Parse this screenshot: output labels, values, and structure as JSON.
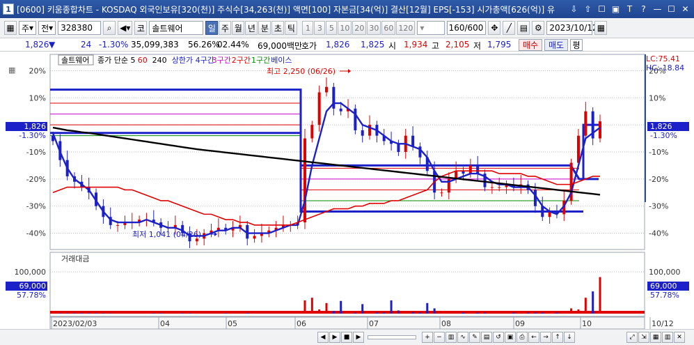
{
  "window": {
    "number": "1",
    "title": "[0600] 키움종합차트 - KOSDAQ 외국인보유[320(천)] 주식수[34,263(천)] 액면[100] 자본금[34(억)] 결산[12월] EPS[-153] 시가총액[626(억)] 유",
    "buttons": [
      "⇩",
      "⇧",
      "☐",
      "▣",
      "T",
      "?",
      "—",
      "☐",
      "✕"
    ]
  },
  "toolbar": {
    "market": "주",
    "scope": "전",
    "code": "328380",
    "name_prefix": "코",
    "name": "솔트웨어",
    "periods": [
      "일",
      "주",
      "월",
      "년",
      "분",
      "초",
      "틱"
    ],
    "active_period": "일",
    "ticks": [
      "1",
      "3",
      "5",
      "10",
      "20",
      "30",
      "60",
      "120"
    ],
    "count": "160",
    "count_total": "/600",
    "date": "2023/10/12"
  },
  "quote": {
    "price": "1,826",
    "change_arrow": "▼",
    "change": "24",
    "change_pct": "-1.30%",
    "volume": "35,099,383",
    "turnover": "56.26%",
    "ratio": "02.44%",
    "amount": "69,000백만",
    "ask_label": "호가",
    "ask": "1,826",
    "bid": "1,825",
    "open_label": "시",
    "open": "1,934",
    "high_label": "고",
    "high": "2,105",
    "low_label": "저",
    "low": "1,795",
    "buy": "매수",
    "sell": "매도",
    "eval": "평"
  },
  "legend": {
    "stock": "솔트웨어",
    "items": [
      {
        "text": "종가 단순 5",
        "color": "#000"
      },
      {
        "text": "60",
        "color": "#e00000"
      },
      {
        "text": "240",
        "color": "#000"
      },
      {
        "text": "상한가 4구간",
        "color": "#1c20c8"
      },
      {
        "text": "3구간",
        "color": "#cc00cc"
      },
      {
        "text": "2구간",
        "color": "#e00000"
      },
      {
        "text": "1구간",
        "color": "#008800"
      },
      {
        "text": "베이스",
        "color": "#1c20c8"
      }
    ]
  },
  "annotations": {
    "high": "최고 2,250 (06/26)",
    "low": "최저 1,041 (04/26)"
  },
  "right_labels": {
    "lc": "LC:75.41",
    "hc": "HC:-18.84"
  },
  "price_box": {
    "price": "1,826",
    "pct": "-1.30%"
  },
  "volume_panel": {
    "title": "거래대금",
    "axis_label": "100,000",
    "value": "69,000",
    "pct": "57.78%"
  },
  "x_axis": {
    "labels": [
      "2023/02/03",
      "04",
      "05",
      "06",
      "07",
      "08",
      "09",
      "10",
      "10/12"
    ]
  },
  "colors": {
    "up": "#e00000",
    "down": "#1c20c8",
    "ma5": "#1c20c8",
    "ma60": "#e00000",
    "ma240": "#000000"
  },
  "chart_data": [
    {
      "type": "line",
      "title": "솔트웨어",
      "y_axis": {
        "labels": [
          "20%",
          "10%",
          "0%",
          "-10%",
          "-20%",
          "-30%",
          "-40%"
        ],
        "range": [
          -45,
          25
        ]
      },
      "series": [
        {
          "name": "종가",
          "values": [
            -6,
            -13,
            -19,
            -21,
            -23,
            -25,
            -30,
            -34,
            -37,
            -37,
            -36,
            -36,
            -35,
            -35,
            -36,
            -38,
            -38,
            -37,
            -40,
            -43,
            -42,
            -40,
            -39,
            -38,
            -39,
            -38,
            -37,
            -42,
            -41,
            -40,
            -39,
            -38,
            -37,
            -37,
            -36,
            -5,
            0,
            12,
            14,
            6,
            5,
            6,
            -2,
            -4,
            0,
            -4,
            -6,
            -7,
            -10,
            -4,
            -8,
            -12,
            -17,
            -25,
            -25,
            -20,
            -17,
            -18,
            -15,
            -18,
            -23,
            -23,
            -23,
            -22,
            -23,
            -22,
            -24,
            -30,
            -34,
            -32,
            -33,
            -28,
            -14,
            -4,
            5,
            -5,
            1.3
          ]
        },
        {
          "name": "5",
          "values": [
            -3,
            -10,
            -16,
            -20,
            -22,
            -24,
            -28,
            -32,
            -35,
            -36,
            -36,
            -36,
            -36,
            -35,
            -36,
            -37,
            -38,
            -38,
            -39,
            -41,
            -41,
            -41,
            -40,
            -39,
            -39,
            -38,
            -38,
            -40,
            -40,
            -40,
            -40,
            -39,
            -38,
            -37,
            -37,
            -28,
            -15,
            -5,
            5,
            8,
            8,
            6,
            4,
            0,
            -1,
            -2,
            -4,
            -6,
            -7,
            -7,
            -8,
            -9,
            -12,
            -17,
            -21,
            -21,
            -20,
            -19,
            -18,
            -18,
            -19,
            -21,
            -22,
            -22,
            -23,
            -23,
            -23,
            -26,
            -30,
            -32,
            -33,
            -30,
            -25,
            -15,
            -5,
            -3,
            -1
          ]
        },
        {
          "name": "60",
          "values": [
            -25,
            -24,
            -23,
            -23,
            -23,
            -23,
            -23,
            -23,
            -23,
            -23,
            -24,
            -24,
            -25,
            -26,
            -27,
            -28,
            -28,
            -29,
            -30,
            -31,
            -32,
            -33,
            -33,
            -34,
            -35,
            -35,
            -36,
            -36,
            -37,
            -37,
            -37,
            -37,
            -37,
            -37,
            -36,
            -35,
            -34,
            -33,
            -32,
            -31,
            -31,
            -31,
            -30,
            -30,
            -29,
            -29,
            -29,
            -28,
            -28,
            -27,
            -26,
            -25,
            -24,
            -21,
            -19,
            -18,
            -17,
            -17,
            -17,
            -17,
            -17,
            -17,
            -18,
            -18,
            -18,
            -18,
            -19,
            -19,
            -20,
            -21,
            -22,
            -22,
            -22,
            -21,
            -20,
            -19,
            -19
          ]
        },
        {
          "name": "240",
          "values": [
            -1,
            -1.5,
            -2,
            -2.3,
            -2.7,
            -3,
            -3.4,
            -3.8,
            -4.2,
            -4.6,
            -5,
            -5.4,
            -5.8,
            -6.2,
            -6.6,
            -7,
            -7.4,
            -7.8,
            -8.2,
            -8.6,
            -9,
            -9.3,
            -9.6,
            -9.9,
            -10.2,
            -10.5,
            -10.8,
            -11.1,
            -11.4,
            -11.7,
            -12,
            -12.3,
            -12.6,
            -12.9,
            -13.2,
            -13.5,
            -13.8,
            -14.1,
            -14.4,
            -14.7,
            -15,
            -15.3,
            -15.6,
            -15.9,
            -16.2,
            -16.5,
            -16.8,
            -17.1,
            -17.4,
            -17.7,
            -18,
            -18.3,
            -18.6,
            -18.9,
            -19.2,
            -19.5,
            -19.8,
            -20.1,
            -20.4,
            -20.7,
            -21,
            -21.3,
            -21.6,
            -21.9,
            -22.2,
            -22.5,
            -22.8,
            -23.1,
            -23.4,
            -23.7,
            -24,
            -24.3,
            -24.6,
            -24.9,
            -25.2,
            -25.5,
            -25.8
          ]
        }
      ]
    },
    {
      "type": "bar",
      "title": "거래대금",
      "y_axis": {
        "labels": [
          "100,000"
        ]
      },
      "values": [
        2,
        1,
        1,
        1,
        1,
        1,
        1,
        1,
        1,
        1,
        1,
        1,
        1,
        1,
        1,
        1,
        1,
        1,
        1,
        1,
        1,
        1,
        1,
        1,
        1,
        1,
        1,
        1,
        1,
        1,
        1,
        1,
        1,
        1,
        1,
        25,
        30,
        8,
        20,
        5,
        24,
        3,
        2,
        18,
        4,
        2,
        2,
        25,
        6,
        2,
        3,
        2,
        20,
        10,
        2,
        2,
        4,
        2,
        2,
        2,
        2,
        2,
        2,
        2,
        2,
        2,
        2,
        2,
        2,
        2,
        2,
        2,
        10,
        8,
        30,
        42,
        69
      ]
    }
  ]
}
